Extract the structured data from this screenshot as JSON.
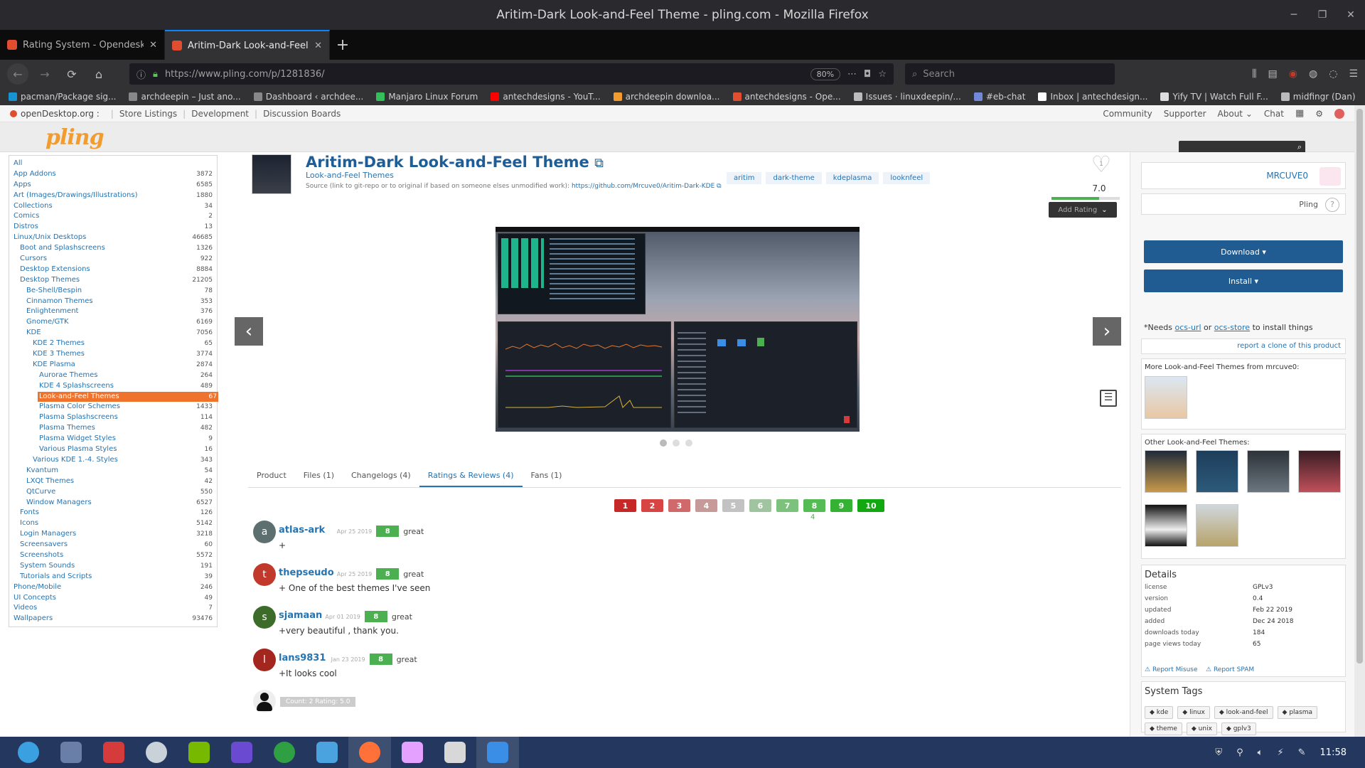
{
  "window": {
    "title": "Aritim-Dark Look-and-Feel Theme - pling.com - Mozilla Firefox"
  },
  "tabs": [
    {
      "title": "Rating System - Opendesktop",
      "color": "#e04e2f"
    },
    {
      "title": "Aritim-Dark Look-and-Feel Th",
      "color": "#e04e2f"
    }
  ],
  "nav": {
    "url": "https://www.pling.com/p/1281836/",
    "zoom": "80%",
    "search_placeholder": "Search"
  },
  "bookmarks": [
    {
      "label": "pacman/Package sig...",
      "color": "#1793d1"
    },
    {
      "label": "archdeepin – Just ano...",
      "color": "#888888"
    },
    {
      "label": "Dashboard ‹ archdee...",
      "color": "#888888"
    },
    {
      "label": "Manjaro Linux Forum",
      "color": "#35bf5c"
    },
    {
      "label": "antechdesigns - YouT...",
      "color": "#ff0000"
    },
    {
      "label": "archdeepin downloa...",
      "color": "#f29b2e"
    },
    {
      "label": "antechdesigns - Ope...",
      "color": "#e04e2f"
    },
    {
      "label": "Issues · linuxdeepin/...",
      "color": "#bbbbbb"
    },
    {
      "label": "#eb-chat",
      "color": "#7289da"
    },
    {
      "label": "Inbox | antechdesign...",
      "color": "#ffffff"
    },
    {
      "label": "Yify TV | Watch Full F...",
      "color": "#dddddd"
    },
    {
      "label": "midfingr (Dan)",
      "color": "#bbbbbb"
    }
  ],
  "od": {
    "brand": "openDesktop.org :",
    "links": [
      "Store Listings",
      "Development",
      "Discussion Boards"
    ],
    "right": [
      "Community",
      "Supporter",
      "About ⌄",
      "Chat"
    ]
  },
  "site": {
    "logo": "pling"
  },
  "categories": [
    {
      "label": "All",
      "count": "",
      "indent": 0
    },
    {
      "label": "App Addons",
      "count": "3872",
      "indent": 0
    },
    {
      "label": "Apps",
      "count": "6585",
      "indent": 0
    },
    {
      "label": "Art (Images/Drawings/Illustrations)",
      "count": "1880",
      "indent": 0
    },
    {
      "label": "Collections",
      "count": "34",
      "indent": 0
    },
    {
      "label": "Comics",
      "count": "2",
      "indent": 0
    },
    {
      "label": "Distros",
      "count": "13",
      "indent": 0
    },
    {
      "label": "Linux/Unix Desktops",
      "count": "46685",
      "indent": 0
    },
    {
      "label": "Boot and Splashscreens",
      "count": "1326",
      "indent": 1
    },
    {
      "label": "Cursors",
      "count": "922",
      "indent": 1
    },
    {
      "label": "Desktop Extensions",
      "count": "8884",
      "indent": 1
    },
    {
      "label": "Desktop Themes",
      "count": "21205",
      "indent": 1
    },
    {
      "label": "Be-Shell/Bespin",
      "count": "78",
      "indent": 2
    },
    {
      "label": "Cinnamon Themes",
      "count": "353",
      "indent": 2
    },
    {
      "label": "Enlightenment",
      "count": "376",
      "indent": 2
    },
    {
      "label": "Gnome/GTK",
      "count": "6169",
      "indent": 2
    },
    {
      "label": "KDE",
      "count": "7056",
      "indent": 2
    },
    {
      "label": "KDE 2 Themes",
      "count": "65",
      "indent": 3
    },
    {
      "label": "KDE 3 Themes",
      "count": "3774",
      "indent": 3
    },
    {
      "label": "KDE Plasma",
      "count": "2874",
      "indent": 3
    },
    {
      "label": "Aurorae Themes",
      "count": "264",
      "indent": 4
    },
    {
      "label": "KDE 4 Splashscreens",
      "count": "489",
      "indent": 4
    },
    {
      "label": "Look-and-Feel Themes",
      "count": "67",
      "indent": 4,
      "active": true
    },
    {
      "label": "Plasma Color Schemes",
      "count": "1433",
      "indent": 4
    },
    {
      "label": "Plasma Splashscreens",
      "count": "114",
      "indent": 4
    },
    {
      "label": "Plasma Themes",
      "count": "482",
      "indent": 4
    },
    {
      "label": "Plasma Widget Styles",
      "count": "9",
      "indent": 4
    },
    {
      "label": "Various Plasma Styles",
      "count": "16",
      "indent": 4
    },
    {
      "label": "Various KDE 1.-4. Styles",
      "count": "343",
      "indent": 3
    },
    {
      "label": "Kvantum",
      "count": "54",
      "indent": 2
    },
    {
      "label": "LXQt Themes",
      "count": "42",
      "indent": 2
    },
    {
      "label": "QtCurve",
      "count": "550",
      "indent": 2
    },
    {
      "label": "Window Managers",
      "count": "6527",
      "indent": 2
    },
    {
      "label": "Fonts",
      "count": "126",
      "indent": 1
    },
    {
      "label": "Icons",
      "count": "5142",
      "indent": 1
    },
    {
      "label": "Login Managers",
      "count": "3218",
      "indent": 1
    },
    {
      "label": "Screensavers",
      "count": "60",
      "indent": 1
    },
    {
      "label": "Screenshots",
      "count": "5572",
      "indent": 1
    },
    {
      "label": "System Sounds",
      "count": "191",
      "indent": 1
    },
    {
      "label": "Tutorials and Scripts",
      "count": "39",
      "indent": 1
    },
    {
      "label": "Phone/Mobile",
      "count": "246",
      "indent": 0
    },
    {
      "label": "UI Concepts",
      "count": "49",
      "indent": 0
    },
    {
      "label": "Videos",
      "count": "7",
      "indent": 0
    },
    {
      "label": "Wallpapers",
      "count": "93476",
      "indent": 0
    }
  ],
  "product": {
    "title": "Aritim-Dark Look-and-Feel Theme",
    "category": "Look-and-Feel Themes",
    "source_prefix": "Source (link to git-repo or to original if based on someone elses unmodified work):",
    "source_url": "https://github.com/Mrcuve0/Aritim-Dark-KDE",
    "tags": [
      "aritim",
      "dark-theme",
      "kdeplasma",
      "looknfeel"
    ],
    "likes": "1",
    "score": "7.0",
    "score_fraction": 0.7,
    "add_rating": "Add Rating"
  },
  "content_tabs": [
    "Product",
    "Files (1)",
    "Changelogs (4)",
    "Ratings & Reviews (4)",
    "Fans (1)"
  ],
  "rating_scale": [
    {
      "n": "1",
      "color": "#c62828"
    },
    {
      "n": "2",
      "color": "#d84343"
    },
    {
      "n": "3",
      "color": "#d06a6a"
    },
    {
      "n": "4",
      "color": "#c79a9a"
    },
    {
      "n": "5",
      "color": "#c2c2c2"
    },
    {
      "n": "6",
      "color": "#9fc49f"
    },
    {
      "n": "7",
      "color": "#7cc27c"
    },
    {
      "n": "8",
      "color": "#55bb55"
    },
    {
      "n": "9",
      "color": "#33b233"
    },
    {
      "n": "10",
      "color": "#12a812"
    }
  ],
  "rating_count_under_8": "4",
  "reviews": [
    {
      "initial": "a",
      "color": "#5d6f6f",
      "user": "atlas-ark",
      "date": "Apr 25 2019",
      "score": "8",
      "word": "great",
      "text": "+"
    },
    {
      "initial": "t",
      "color": "#c0392b",
      "user": "thepseudo",
      "date": "Apr 25 2019",
      "score": "8",
      "word": "great",
      "text": "+ One of the best themes I've seen"
    },
    {
      "initial": "s",
      "color": "#3d6b2a",
      "user": "sjamaan",
      "date": "Apr 01 2019",
      "score": "8",
      "word": "great",
      "text": "+very beautiful , thank you."
    },
    {
      "initial": "l",
      "color": "#a3261f",
      "user": "lans9831",
      "date": "Jan 23 2019",
      "score": "8",
      "word": "great",
      "text": "+It looks cool"
    }
  ],
  "rating_summary": "Count: 2 Rating: 5.0",
  "side": {
    "user": "MRCUVE0",
    "pling": "Pling",
    "download": "Download ▾",
    "install": "Install ▾",
    "needs_prefix": "*Needs ",
    "needs_a": "ocs-url",
    "needs_or": " or ",
    "needs_b": "ocs-store",
    "needs_suffix": " to install things",
    "report_clone": "report a clone of this product",
    "more_title": "More Look-and-Feel Themes from mrcuve0:",
    "other_title": "Other Look-and-Feel Themes:"
  },
  "details": {
    "title": "Details",
    "rows": [
      {
        "k": "license",
        "v": "GPLv3"
      },
      {
        "k": "version",
        "v": "0.4"
      },
      {
        "k": "updated",
        "v": "Feb 22 2019"
      },
      {
        "k": "added",
        "v": "Dec 24 2018"
      },
      {
        "k": "downloads today",
        "v": "184"
      },
      {
        "k": "page views today",
        "v": "65"
      }
    ],
    "report_misuse": "Report Misuse",
    "report_spam": "Report SPAM"
  },
  "system_tags": {
    "title": "System Tags",
    "tags": [
      "kde",
      "linux",
      "look-and-feel",
      "plasma",
      "theme",
      "unix",
      "gplv3"
    ]
  },
  "taskbar": {
    "apps": [
      {
        "name": "launcher-icon",
        "color": "#3aa0e0"
      },
      {
        "name": "desktop-icon",
        "color": "#6a7fa8"
      },
      {
        "name": "terminal-icon",
        "color": "#d63b3b"
      },
      {
        "name": "steam-icon",
        "color": "#c9d1d9"
      },
      {
        "name": "nvidia-icon",
        "color": "#76b900"
      },
      {
        "name": "monitor-icon",
        "color": "#6a4ad0"
      },
      {
        "name": "camera-icon",
        "color": "#2ea043"
      },
      {
        "name": "stats-icon",
        "color": "#4aa3df"
      },
      {
        "name": "firefox-icon",
        "color": "#ff7139"
      },
      {
        "name": "color-icon",
        "color": "#e5a1ff"
      },
      {
        "name": "settings-icon",
        "color": "#d8d8d8"
      },
      {
        "name": "store-icon",
        "color": "#3a8ee6"
      }
    ],
    "clock": "11:58"
  }
}
